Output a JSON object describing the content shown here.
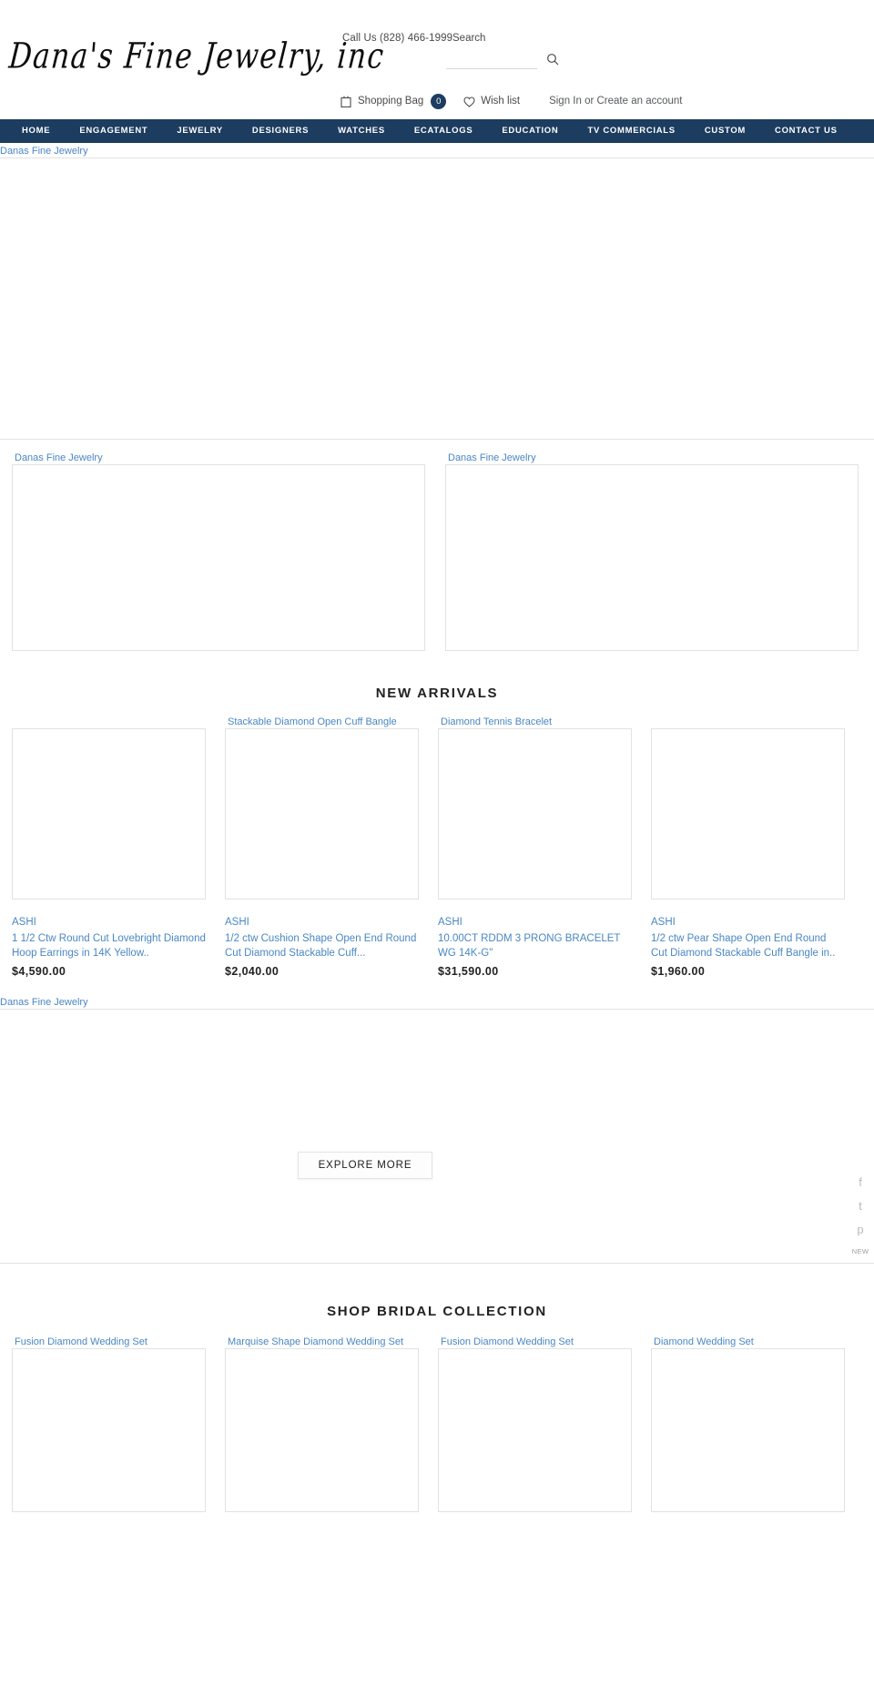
{
  "header": {
    "logo_text": "Dana's Fine Jewelry, inc",
    "call_us": "Call Us (828) 466-1999",
    "search_label": "Search",
    "search_value": "",
    "search_placeholder": "",
    "shopping_bag_label": "Shopping Bag",
    "bag_count": "0",
    "wish_list_label": "Wish list",
    "account_label": "Sign In or Create an account",
    "accent_color": "#1c3c60",
    "link_color": "#4a87c4"
  },
  "nav": {
    "items": [
      {
        "label": "HOME"
      },
      {
        "label": "ENGAGEMENT"
      },
      {
        "label": "JEWELRY"
      },
      {
        "label": "DESIGNERS"
      },
      {
        "label": "WATCHES"
      },
      {
        "label": "ECATALOGS"
      },
      {
        "label": "EDUCATION"
      },
      {
        "label": "TV COMMERCIALS"
      },
      {
        "label": "CUSTOM"
      },
      {
        "label": "CONTACT US"
      }
    ]
  },
  "hero": {
    "alt_text": "Danas Fine Jewelry"
  },
  "banners": [
    {
      "alt_text": "Danas Fine Jewelry"
    },
    {
      "alt_text": "Danas Fine Jewelry"
    }
  ],
  "new_arrivals": {
    "title": "NEW ARRIVALS",
    "products": [
      {
        "alt_text": "",
        "brand": "ASHI",
        "name": "1 1/2 Ctw Round Cut Lovebright Diamond Hoop Earrings in 14K Yellow..",
        "price": "$4,590.00"
      },
      {
        "alt_text": "Stackable Diamond Open Cuff Bangle",
        "brand": "ASHI",
        "name": "1/2 ctw Cushion Shape Open End Round Cut Diamond Stackable Cuff...",
        "price": "$2,040.00"
      },
      {
        "alt_text": "Diamond Tennis Bracelet",
        "brand": "ASHI",
        "name": "10.00CT RDDM 3 PRONG BRACELET WG 14K-G\"",
        "price": "$31,590.00"
      },
      {
        "alt_text": "",
        "brand": "ASHI",
        "name": "1/2 ctw Pear Shape Open End Round Cut Diamond Stackable Cuff Bangle in..",
        "price": "$1,960.00"
      }
    ]
  },
  "explore": {
    "alt_text": "Danas Fine Jewelry",
    "button_label": "EXPLORE MORE"
  },
  "bridal": {
    "title": "SHOP BRIDAL COLLECTION",
    "cards": [
      {
        "alt_text": "Fusion Diamond Wedding Set"
      },
      {
        "alt_text": "Marquise Shape Diamond Wedding Set"
      },
      {
        "alt_text": "Fusion Diamond Wedding Set"
      },
      {
        "alt_text": "Diamond Wedding Set"
      }
    ]
  },
  "social": {
    "facebook": "f",
    "twitter": "t",
    "pinterest": "p",
    "new_label": "NEW"
  }
}
